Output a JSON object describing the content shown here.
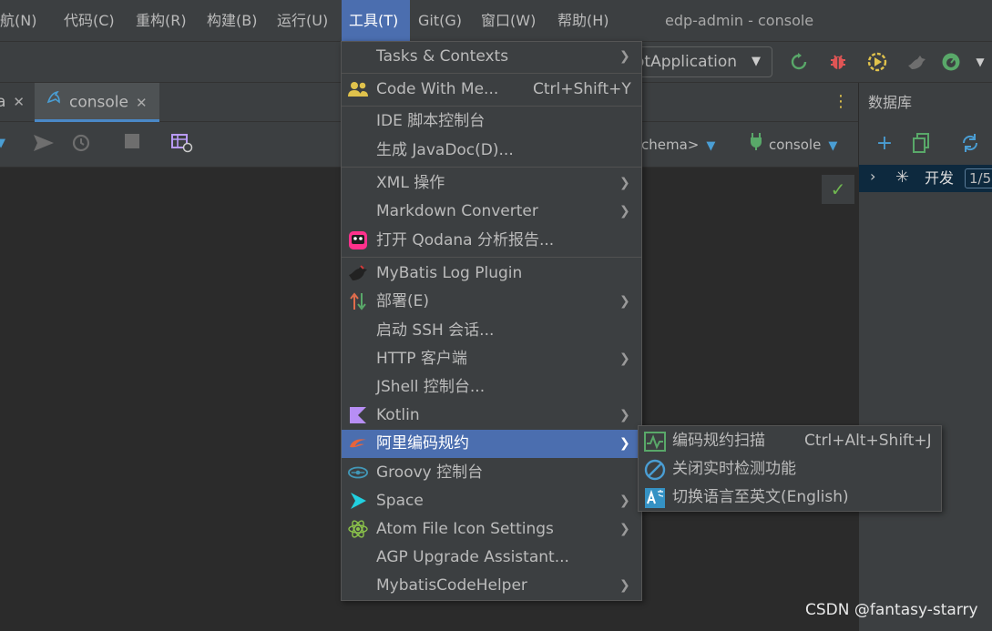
{
  "window": {
    "title": "edp-admin - console"
  },
  "menubar": {
    "items": [
      {
        "label": "导航(N)"
      },
      {
        "label": "代码(C)"
      },
      {
        "label": "重构(R)"
      },
      {
        "label": "构建(B)"
      },
      {
        "label": "运行(U)"
      },
      {
        "label": "工具(T)"
      },
      {
        "label": "Git(G)"
      },
      {
        "label": "窗口(W)"
      },
      {
        "label": "帮助(H)"
      }
    ],
    "active": "工具(T)"
  },
  "toolbar": {
    "run_config": "otApplication",
    "icons": [
      "rerun-icon",
      "debug-icon",
      "coverage-icon",
      "profile-icon",
      "dashboard-icon"
    ]
  },
  "tabs": [
    {
      "label": "a"
    },
    {
      "label": "console"
    }
  ],
  "console_toolbar": {
    "schema": "chema>",
    "session": "console"
  },
  "db_panel": {
    "title": "数据库",
    "tree": [
      {
        "label": "开发",
        "count": "1/5"
      }
    ]
  },
  "tools_menu": {
    "items": [
      {
        "label": "Tasks & Contexts",
        "submenu": true
      },
      {
        "label": "Code With Me...",
        "shortcut": "Ctrl+Shift+Y"
      },
      {
        "label": "IDE 脚本控制台"
      },
      {
        "label": "生成 JavaDoc(D)..."
      },
      {
        "label": "XML 操作",
        "submenu": true
      },
      {
        "label": "Markdown Converter",
        "submenu": true
      },
      {
        "label": "打开 Qodana 分析报告..."
      },
      {
        "label": "MyBatis Log Plugin"
      },
      {
        "label": "部署(E)",
        "submenu": true
      },
      {
        "label": "启动 SSH 会话..."
      },
      {
        "label": "HTTP 客户端",
        "submenu": true
      },
      {
        "label": "JShell 控制台..."
      },
      {
        "label": "Kotlin",
        "submenu": true
      },
      {
        "label": "阿里编码规约",
        "submenu": true,
        "highlighted": true
      },
      {
        "label": "Groovy 控制台"
      },
      {
        "label": "Space",
        "submenu": true
      },
      {
        "label": "Atom File Icon Settings",
        "submenu": true
      },
      {
        "label": "AGP Upgrade Assistant..."
      },
      {
        "label": "MybatisCodeHelper",
        "submenu": true
      }
    ]
  },
  "submenu": {
    "items": [
      {
        "label": "编码规约扫描",
        "shortcut": "Ctrl+Alt+Shift+J"
      },
      {
        "label": "关闭实时检测功能"
      },
      {
        "label": "切换语言至英文(English)"
      }
    ]
  },
  "watermark": "CSDN @fantasy-starry",
  "colors": {
    "menu_bg": "#3c3f41",
    "editor_bg": "#2b2b2b",
    "highlight": "#4b6eaf",
    "tab_underline": "#4a88c7"
  }
}
